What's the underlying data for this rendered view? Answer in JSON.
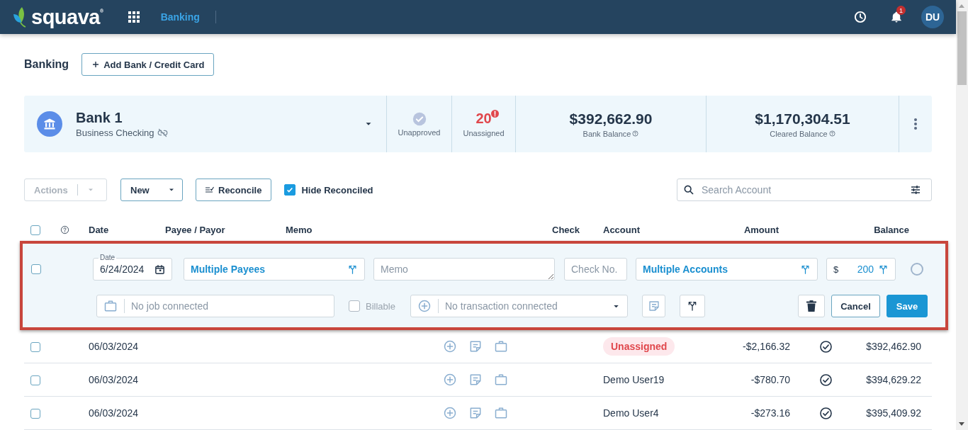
{
  "header": {
    "brand": "squava",
    "brand_mark": "®",
    "nav": "Banking",
    "notifications": "1",
    "avatar": "DU"
  },
  "page": {
    "title": "Banking",
    "add_button": "Add Bank / Credit Card"
  },
  "bank_card": {
    "name": "Bank 1",
    "type": "Business Checking",
    "stats": [
      {
        "kind": "approval",
        "label": "Unapproved"
      },
      {
        "kind": "count",
        "value": "20",
        "label": "Unassigned"
      },
      {
        "kind": "balance",
        "value": "$392,662.90",
        "label": "Bank Balance"
      },
      {
        "kind": "balance",
        "value": "$1,170,304.51",
        "label": "Cleared Balance"
      }
    ]
  },
  "toolbar": {
    "actions": {
      "label": "Actions",
      "disabled": true
    },
    "new": "New",
    "reconcile": "Reconcile",
    "hide_reconciled": {
      "label": "Hide Reconciled",
      "checked": true
    },
    "search": {
      "placeholder": "Search Account"
    }
  },
  "table": {
    "select_all": {
      "checked": false
    },
    "columns": [
      "Date",
      "Payee / Payor",
      "Memo",
      "Check",
      "Account",
      "Amount",
      "Balance"
    ],
    "edit_row": {
      "checked": false,
      "date_label": "Date",
      "date": "6/24/2024",
      "payee": "Multiple Payees",
      "memo_placeholder": "Memo",
      "check_placeholder": "Check No.",
      "account": "Multiple Accounts",
      "currency": "$",
      "amount": "200",
      "job_placeholder": "No job connected",
      "billable": {
        "label": "Billable",
        "checked": false
      },
      "transaction_placeholder": "No transaction connected",
      "selected": false,
      "cancel": "Cancel",
      "save": "Save"
    },
    "rows": [
      {
        "checked": false,
        "date": "06/03/2024",
        "account": {
          "kind": "tag",
          "text": "Unassigned"
        },
        "amount": "-$2,166.32",
        "balance": "$392,462.90"
      },
      {
        "checked": false,
        "date": "06/03/2024",
        "account": {
          "kind": "text",
          "text": "Demo User19"
        },
        "amount": "-$780.70",
        "balance": "$394,629.22"
      },
      {
        "checked": false,
        "date": "06/03/2024",
        "account": {
          "kind": "text",
          "text": "Demo User4"
        },
        "amount": "-$273.16",
        "balance": "$395,409.92"
      }
    ]
  }
}
